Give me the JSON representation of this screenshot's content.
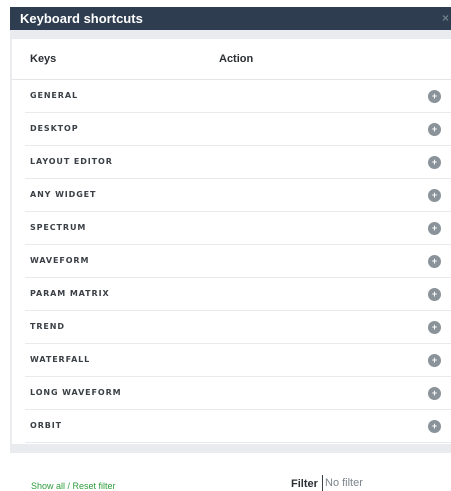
{
  "dialog": {
    "title": "Keyboard shortcuts",
    "close_glyph": "×"
  },
  "table": {
    "headers": {
      "keys": "Keys",
      "action": "Action"
    },
    "rows": [
      {
        "label": "GENERAL",
        "icon": "plus-circle-icon"
      },
      {
        "label": "DESKTOP",
        "icon": "plus-circle-icon"
      },
      {
        "label": "LAYOUT EDITOR",
        "icon": "plus-circle-icon"
      },
      {
        "label": "ANY WIDGET",
        "icon": "plus-circle-icon"
      },
      {
        "label": "SPECTRUM",
        "icon": "plus-circle-icon"
      },
      {
        "label": "WAVEFORM",
        "icon": "plus-circle-icon"
      },
      {
        "label": "PARAM MATRIX",
        "icon": "plus-circle-icon"
      },
      {
        "label": "TREND",
        "icon": "plus-circle-icon"
      },
      {
        "label": "WATERFALL",
        "icon": "plus-circle-icon"
      },
      {
        "label": "LONG WAVEFORM",
        "icon": "plus-circle-icon"
      },
      {
        "label": "ORBIT",
        "icon": "plus-circle-icon"
      }
    ],
    "expand_glyph": "+"
  },
  "footer": {
    "show_all_link": "Show all / Reset filter",
    "filter_label": "Filter",
    "filter_value": "",
    "filter_placeholder": "No filter"
  },
  "colors": {
    "titlebar": "#2e3d4f",
    "link": "#2f9c3c",
    "plus_icon": "#8a9399"
  }
}
